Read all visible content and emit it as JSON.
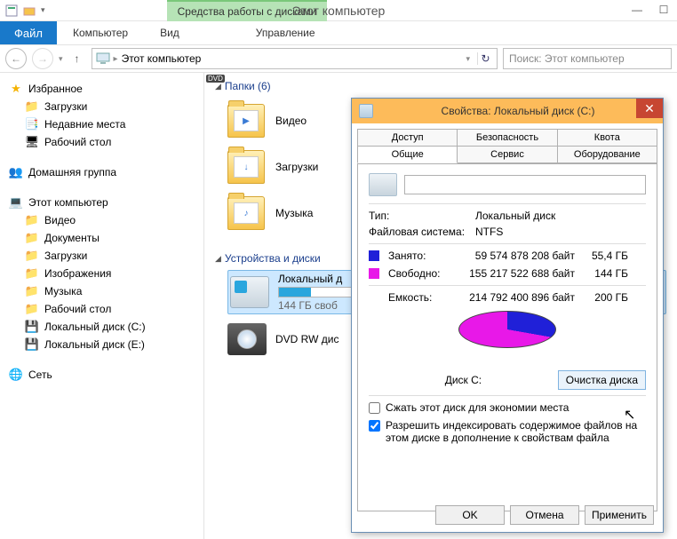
{
  "window_title": "Этот компьютер",
  "context_tab": "Средства работы с дисками",
  "menu": {
    "file": "Файл",
    "computer": "Компьютер",
    "view": "Вид",
    "manage": "Управление"
  },
  "breadcrumb": {
    "location": "Этот компьютер"
  },
  "search_placeholder": "Поиск: Этот компьютер",
  "sidebar": {
    "favorites": {
      "label": "Избранное",
      "items": [
        "Загрузки",
        "Недавние места",
        "Рабочий стол"
      ]
    },
    "homegroup": "Домашняя группа",
    "this_pc": {
      "label": "Этот компьютер",
      "items": [
        "Видео",
        "Документы",
        "Загрузки",
        "Изображения",
        "Музыка",
        "Рабочий стол",
        "Локальный диск (C:)",
        "Локальный диск (E:)"
      ]
    },
    "network": "Сеть"
  },
  "content": {
    "folders_hdr": "Папки (6)",
    "folders": [
      "Видео",
      "Загрузки",
      "Музыка"
    ],
    "devices_hdr": "Устройства и диски",
    "drive_c": {
      "label": "Локальный д",
      "free": "144 ГБ своб",
      "fill_pct": 28
    },
    "dvd": {
      "label": "DVD RW дис"
    }
  },
  "dialog": {
    "title": "Свойства: Локальный диск (C:)",
    "tabs_row1": [
      "Доступ",
      "Безопасность",
      "Квота"
    ],
    "tabs_row2": [
      "Общие",
      "Сервис",
      "Оборудование"
    ],
    "active_tab": "Общие",
    "type_label": "Тип:",
    "type_value": "Локальный диск",
    "fs_label": "Файловая система:",
    "fs_value": "NTFS",
    "used_label": "Занято:",
    "used_bytes": "59 574 878 208 байт",
    "used_gb": "55,4 ГБ",
    "used_color": "#2020d8",
    "free_label": "Свободно:",
    "free_bytes": "155 217 522 688 байт",
    "free_gb": "144 ГБ",
    "free_color": "#e818e8",
    "cap_label": "Емкость:",
    "cap_bytes": "214 792 400 896 байт",
    "cap_gb": "200 ГБ",
    "disk_label": "Диск C:",
    "clean_btn": "Очистка диска",
    "chk1": "Сжать этот диск для экономии места",
    "chk2": "Разрешить индексировать содержимое файлов на этом диске в дополнение к свойствам файла",
    "ok": "OK",
    "cancel": "Отмена",
    "apply": "Применить"
  },
  "chart_data": {
    "type": "pie",
    "title": "Диск C:",
    "series": [
      {
        "name": "Занято",
        "value": 59574878208,
        "display": "55,4 ГБ",
        "color": "#2020d8"
      },
      {
        "name": "Свободно",
        "value": 155217522688,
        "display": "144 ГБ",
        "color": "#e818e8"
      }
    ],
    "total": {
      "name": "Емкость",
      "value": 214792400896,
      "display": "200 ГБ"
    }
  }
}
